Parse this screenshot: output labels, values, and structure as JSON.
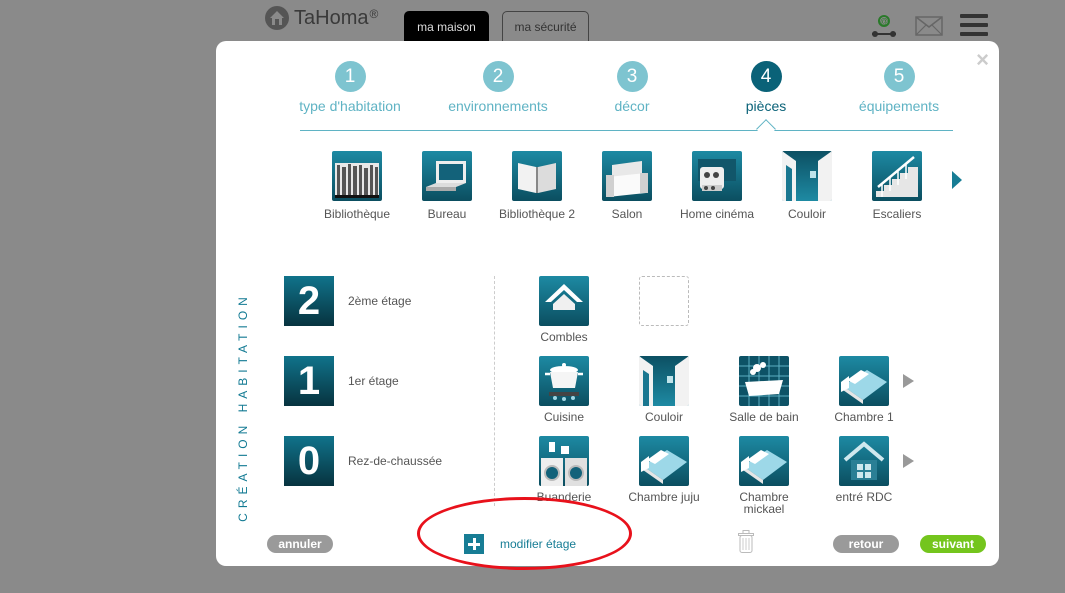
{
  "header": {
    "logo_text": "TaHoma",
    "logo_mark": "®",
    "tabs": [
      {
        "label": "ma maison",
        "active": true
      },
      {
        "label": "ma sécurité",
        "active": false
      }
    ],
    "icons": [
      "contact-icon",
      "mail-icon",
      "menu-icon"
    ]
  },
  "modal": {
    "close_glyph": "×",
    "steps": [
      {
        "num": "1",
        "label": "type d'habitation",
        "active": false
      },
      {
        "num": "2",
        "label": "environnements",
        "active": false
      },
      {
        "num": "3",
        "label": "décor",
        "active": false
      },
      {
        "num": "4",
        "label": "pièces",
        "active": true
      },
      {
        "num": "5",
        "label": "équipements",
        "active": false
      }
    ],
    "palette": [
      {
        "label": "Bibliothèque",
        "icon": "bookshelf-icon"
      },
      {
        "label": "Bureau",
        "icon": "laptop-icon"
      },
      {
        "label": "Bibliothèque 2",
        "icon": "open-book-icon"
      },
      {
        "label": "Salon",
        "icon": "armchair-icon"
      },
      {
        "label": "Home cinéma",
        "icon": "projector-icon"
      },
      {
        "label": "Couloir",
        "icon": "doorway-icon"
      },
      {
        "label": "Escaliers",
        "icon": "stairs-icon"
      }
    ],
    "side_title": "CRÉATION HABITATION",
    "floors": [
      {
        "num": "2",
        "label": "2ème étage"
      },
      {
        "num": "1",
        "label": "1er étage"
      },
      {
        "num": "0",
        "label": "Rez-de-chaussée"
      }
    ],
    "rooms": {
      "floor2": [
        {
          "label": "Combles",
          "icon": "attic-icon"
        }
      ],
      "floor1": [
        {
          "label": "Cuisine",
          "icon": "cooking-pot-icon"
        },
        {
          "label": "Couloir",
          "icon": "doorway-icon"
        },
        {
          "label": "Salle de bain",
          "icon": "bathtub-icon"
        },
        {
          "label": "Chambre 1",
          "icon": "bed-icon"
        }
      ],
      "floor0": [
        {
          "label": "Buanderie",
          "icon": "washing-machine-icon"
        },
        {
          "label": "Chambre juju",
          "icon": "bed-icon"
        },
        {
          "label": "Chambre mickael",
          "icon": "bed-icon"
        },
        {
          "label": "entré RDC",
          "icon": "house-icon"
        }
      ]
    },
    "buttons": {
      "annuler": "annuler",
      "modifier_etage": "modifier étage",
      "retour": "retour",
      "suivant": "suivant"
    },
    "colors": {
      "accent": "#0a6278",
      "step_light": "#7ec4d0",
      "suivant": "#74c51d",
      "highlight": "#e8111b"
    }
  }
}
